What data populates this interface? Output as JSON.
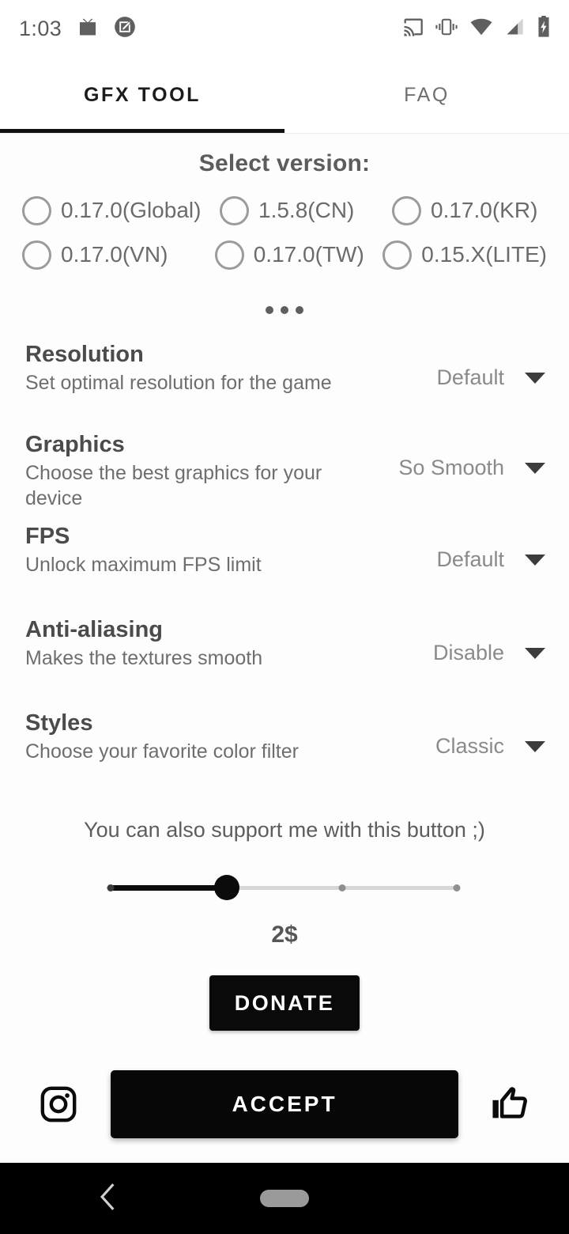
{
  "statusbar": {
    "time": "1:03",
    "left_icons": [
      "tv-icon",
      "screenshot-edit-icon"
    ],
    "right_icons": [
      "cast-icon",
      "vibrate-icon",
      "wifi-icon",
      "cell-signal-icon",
      "battery-charging-icon"
    ]
  },
  "tabs": [
    {
      "label": "GFX TOOL",
      "active": true
    },
    {
      "label": "FAQ",
      "active": false
    }
  ],
  "version_section": {
    "title": "Select version:",
    "options": [
      {
        "label": "0.17.0(Global)",
        "selected": false
      },
      {
        "label": "1.5.8(CN)",
        "selected": false
      },
      {
        "label": "0.17.0(KR)",
        "selected": false
      },
      {
        "label": "0.17.0(VN)",
        "selected": false
      },
      {
        "label": "0.17.0(TW)",
        "selected": false
      },
      {
        "label": "0.15.X(LITE)",
        "selected": false
      }
    ],
    "more_label": "..."
  },
  "settings": [
    {
      "title": "Resolution",
      "subtitle": "Set optimal resolution for the game",
      "value": "Default"
    },
    {
      "title": "Graphics",
      "subtitle": "Choose the best graphics for your device",
      "value": "So Smooth"
    },
    {
      "title": "FPS",
      "subtitle": "Unlock maximum FPS limit",
      "value": "Default"
    },
    {
      "title": "Anti-aliasing",
      "subtitle": "Makes the textures smooth",
      "value": "Disable"
    },
    {
      "title": "Styles",
      "subtitle": "Choose your favorite color filter",
      "value": "Classic"
    }
  ],
  "donate": {
    "support_text": "You can also support me with this button ;)",
    "amount": "2$",
    "slider": {
      "value": 2,
      "min": 1,
      "max": 4,
      "ticks": 4,
      "filled_index": 2
    },
    "button_label": "DONATE"
  },
  "bottom": {
    "instagram_icon": "instagram-icon",
    "accept_label": "ACCEPT",
    "thumbs_up_icon": "thumbs-up-icon"
  },
  "navbar": {
    "back_icon": "back-chevron-icon",
    "home_icon": "home-pill-icon"
  },
  "colors": {
    "accent": "#0a0a0a",
    "background": "#fdfdfd",
    "text_primary": "#4b4b4b",
    "text_secondary": "#6e6e6e",
    "text_muted": "#8a8a8a",
    "navbar": "#000000"
  }
}
